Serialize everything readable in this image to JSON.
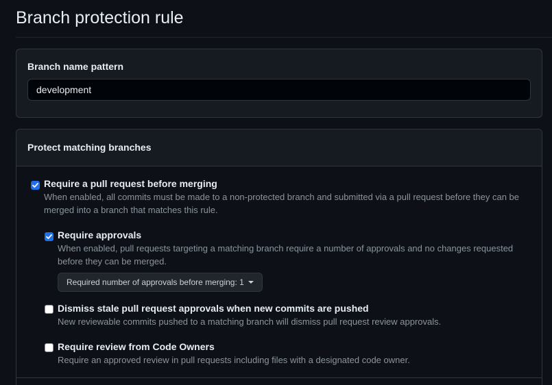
{
  "page": {
    "title": "Branch protection rule"
  },
  "pattern_box": {
    "label": "Branch name pattern",
    "value": "development"
  },
  "protect_box": {
    "title": "Protect matching branches",
    "options": [
      {
        "title": "Require a pull request before merging",
        "description": "When enabled, all commits must be made to a non-protected branch and submitted via a pull request before they can be merged into a branch that matches this rule.",
        "checked": true
      },
      {
        "title": "Require approvals",
        "description": "When enabled, pull requests targeting a matching branch require a number of approvals and no changes requested before they can be merged.",
        "checked": true,
        "select_label": "Required number of approvals before merging: 1"
      },
      {
        "title": "Dismiss stale pull request approvals when new commits are pushed",
        "description": "New reviewable commits pushed to a matching branch will dismiss pull request review approvals.",
        "checked": false
      },
      {
        "title": "Require review from Code Owners",
        "description": "Require an approved review in pull requests including files with a designated code owner.",
        "checked": false
      }
    ]
  },
  "colors": {
    "background": "#0d1117",
    "panel": "#161b22",
    "border": "#30363d",
    "accent": "#1f6feb",
    "text": "#e6edf3",
    "muted": "#8b949e"
  }
}
